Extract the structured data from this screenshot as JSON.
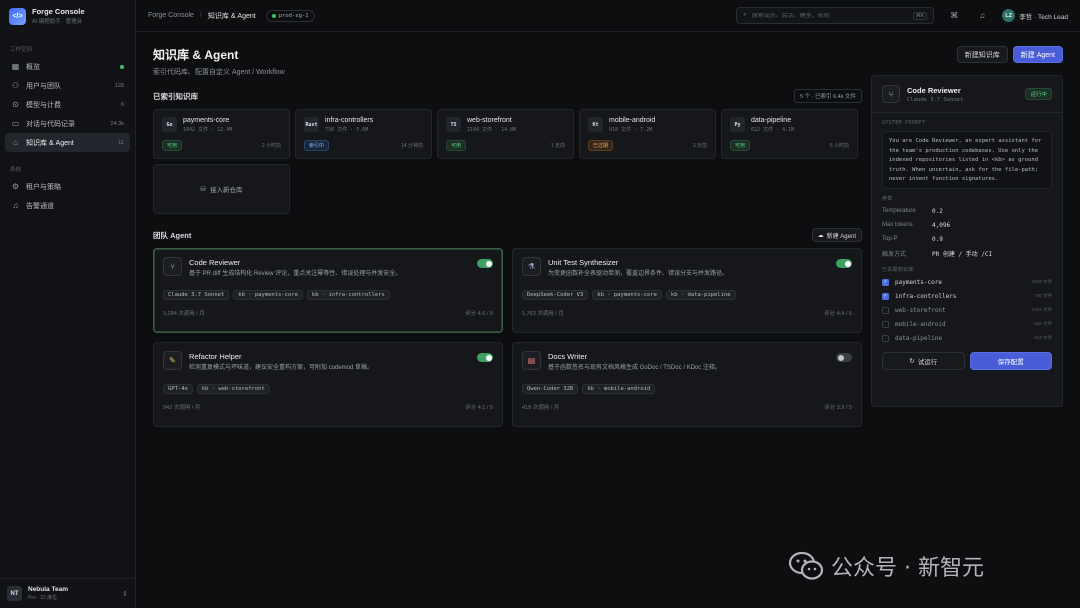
{
  "brand": {
    "name": "Forge Console",
    "subtitle": "AI 编程助手 · 管理台",
    "logo_glyph": "</>"
  },
  "sidebar": {
    "section_workspace": "工作空间",
    "section_system": "系统",
    "items": [
      {
        "label": "概览",
        "icon": "overview-icon",
        "glyph": "▦",
        "badge": "dot"
      },
      {
        "label": "用户与团队",
        "icon": "users-icon",
        "glyph": "⚇",
        "count": "128"
      },
      {
        "label": "模型与计费",
        "icon": "model-icon",
        "glyph": "⊙",
        "count": "6"
      },
      {
        "label": "对话与代码记录",
        "icon": "chat-icon",
        "glyph": "▭",
        "count": "24.3k"
      },
      {
        "label": "知识库 & Agent",
        "icon": "knowledge-icon",
        "glyph": "⌂",
        "count": "11",
        "active": true
      }
    ],
    "system_items": [
      {
        "label": "租户与策略",
        "icon": "tenant-icon",
        "glyph": "⚙"
      },
      {
        "label": "告警通道",
        "icon": "bell-icon",
        "glyph": "♫"
      }
    ],
    "team": {
      "initials": "NT",
      "name": "Nebula Team",
      "sub": "Pro · 32 席位"
    }
  },
  "topbar": {
    "crumb_root": "Forge Console",
    "crumb_current": "知识库 & Agent",
    "env": "prod-sg-1",
    "search_placeholder": "搜索成员、会话、模型、规则",
    "search_kbd": "⌘K",
    "user_initials": "LZ",
    "user_label": "李哲 · Tech Lead"
  },
  "page": {
    "title": "知识库 & Agent",
    "subtitle": "索引代码库、配置自定义 Agent / Workflow",
    "btn_new_kb": "新建知识库",
    "btn_new_agent": "新建 Agent"
  },
  "kb_section": {
    "title": "已索引知识库",
    "meta": "5 个 · 已索引 6.4k 文件",
    "add_label": "接入新仓库",
    "items": [
      {
        "lang": "Go",
        "name": "payments-core",
        "meta": "1842 文件 · 12.4M",
        "status": "可用",
        "status_kind": "green",
        "time": "2 小时前"
      },
      {
        "lang": "Rust",
        "name": "infra-controllers",
        "meta": "736 文件 · 5.6M",
        "status": "索引中",
        "status_kind": "blue",
        "time": "14 分钟前"
      },
      {
        "lang": "TS",
        "name": "web-storefront",
        "meta": "2104 文件 · 14.8M",
        "status": "可用",
        "status_kind": "green",
        "time": "1 天前"
      },
      {
        "lang": "Kt",
        "name": "mobile-android",
        "meta": "918 文件 · 7.2M",
        "status": "已过期",
        "status_kind": "orange",
        "time": "3 天前"
      },
      {
        "lang": "Py",
        "name": "data-pipeline",
        "meta": "612 文件 · 4.1M",
        "status": "可用",
        "status_kind": "green",
        "time": "6 小时前"
      }
    ]
  },
  "agent_section": {
    "title": "团队 Agent",
    "btn_new": "新建 Agent",
    "items": [
      {
        "name": "Code Reviewer",
        "glyph": "⑂",
        "glyph_color": "#7fc59a",
        "on": true,
        "selected": true,
        "desc": "基于 PR diff 生成结构化 Review 评论，重点关注幂等性、错误处理与并发安全。",
        "tags": [
          "Claude 3.7 Sonnet",
          "kb · payments-core",
          "kb · infra-controllers"
        ],
        "usage": "3,284 次调用 / 月",
        "score": "评分 4.6 / 5"
      },
      {
        "name": "Unit Test Synthesizer",
        "glyph": "⚗",
        "glyph_color": "#9fb8d8",
        "on": true,
        "selected": false,
        "desc": "为变更函数补全表驱动单测，覆盖边界条件、错误分支与并发路径。",
        "tags": [
          "DeepSeek-Coder V3",
          "kb · payments-core",
          "kb · data-pipeline"
        ],
        "usage": "1,763 次调用 / 月",
        "score": "评分 4.4 / 5"
      },
      {
        "name": "Refactor Helper",
        "glyph": "✎",
        "glyph_color": "#e6c36a",
        "on": true,
        "selected": false,
        "desc": "检测重复模式与坏味道，建议安全重构方案，可附加 codemod 草稿。",
        "tags": [
          "GPT-4o",
          "kb · web-storefront"
        ],
        "usage": "942 次调用 / 月",
        "score": "评分 4.1 / 5"
      },
      {
        "name": "Docs Writer",
        "glyph": "▤",
        "glyph_color": "#e27b7b",
        "on": false,
        "selected": false,
        "desc": "基于函数签名与现有文档风格生成 GoDoc / TSDoc / KDoc 注释。",
        "tags": [
          "Qwen-Coder 32B",
          "kb · mobile-android"
        ],
        "usage": "418 次调用 / 月",
        "score": "评分 3.9 / 5"
      }
    ]
  },
  "panel": {
    "name": "Code Reviewer",
    "model": "Claude 3.7 Sonnet",
    "status": "运行中",
    "prompt_label": "SYSTEM PROMPT",
    "prompt": "You are Code Reviewer, an expert assistant for the team's production codebases. Use only the indexed repositories listed in <kb> as ground truth. When uncertain, ask for the file-path; never invent function signatures.",
    "params_label": "参数",
    "params": [
      {
        "k": "Temperature",
        "v": "0.2"
      },
      {
        "k": "Max tokens",
        "v": "4,096"
      },
      {
        "k": "Top-P",
        "v": "0.9"
      },
      {
        "k": "触发方式",
        "v": "PR 创建 / 手动 /CI"
      }
    ],
    "kb_label": "已关联知识库",
    "kbs": [
      {
        "name": "payments-core",
        "count": "1842 文件",
        "on": true
      },
      {
        "name": "infra-controllers",
        "count": "736 文件",
        "on": true
      },
      {
        "name": "web-storefront",
        "count": "2104 文件",
        "on": false
      },
      {
        "name": "mobile-android",
        "count": "918 文件",
        "on": false
      },
      {
        "name": "data-pipeline",
        "count": "612 文件",
        "on": false
      }
    ],
    "btn_test": "试运行",
    "btn_save": "保存配置"
  },
  "watermark": {
    "text": "公众号 · 新智元"
  }
}
